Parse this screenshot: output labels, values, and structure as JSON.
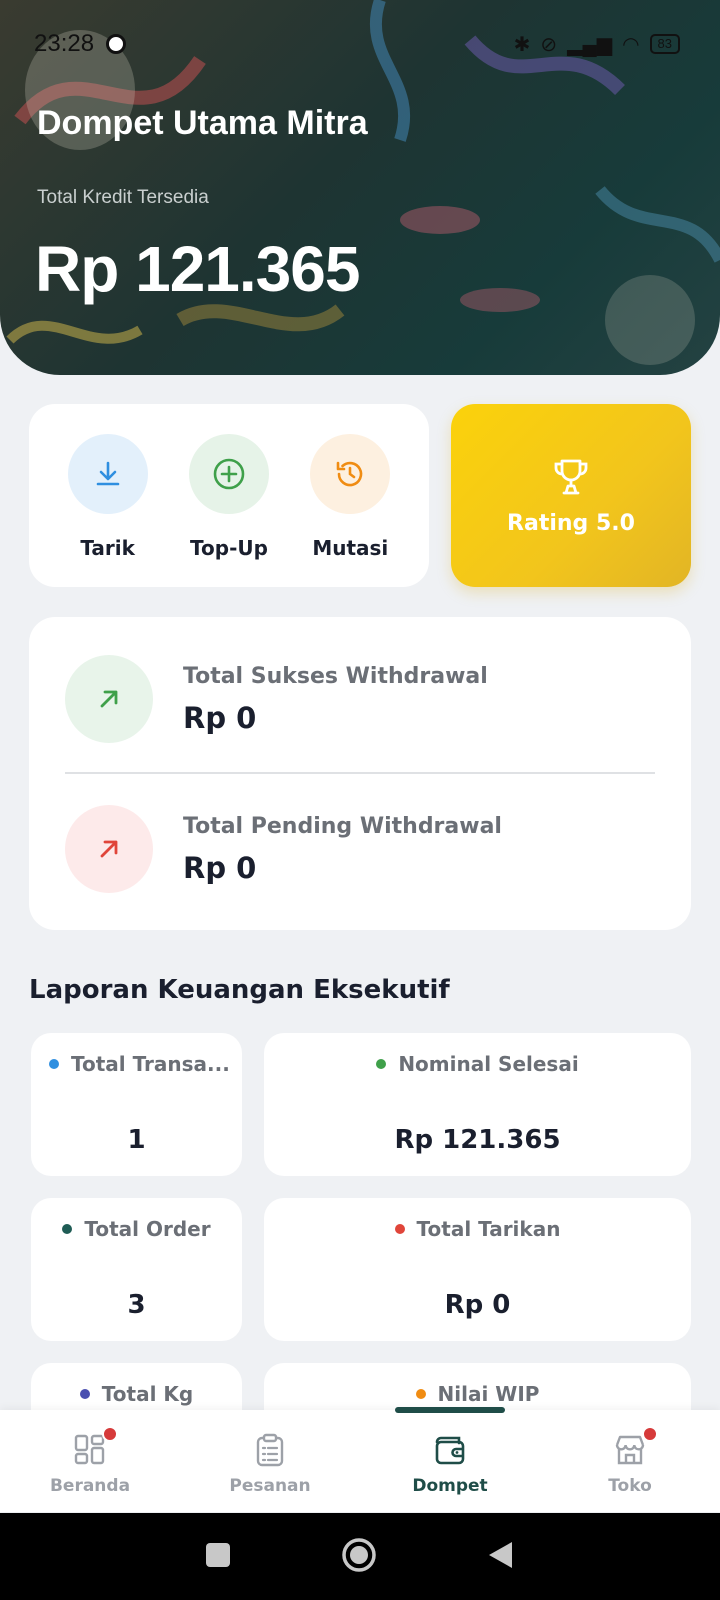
{
  "status_bar": {
    "time": "23:28",
    "battery": "83"
  },
  "wallet": {
    "title": "Dompet Utama Mitra",
    "subtitle": "Total Kredit Tersedia",
    "amount": "Rp 121.365"
  },
  "actions": [
    {
      "label": "Tarik",
      "icon": "download-icon"
    },
    {
      "label": "Top-Up",
      "icon": "plus-circle-icon"
    },
    {
      "label": "Mutasi",
      "icon": "history-icon"
    }
  ],
  "rating": {
    "label": "Rating 5.0",
    "icon": "trophy-icon"
  },
  "withdrawal": {
    "success": {
      "label": "Total Sukses Withdrawal",
      "value": "Rp 0"
    },
    "pending": {
      "label": "Total Pending Withdrawal",
      "value": "Rp 0"
    }
  },
  "report": {
    "title": "Laporan Keuangan Eksekutif",
    "stats": [
      {
        "label": "Total Transa...",
        "value": "1",
        "color": "#2f8fe0"
      },
      {
        "label": "Nominal Selesai",
        "value": "Rp 121.365",
        "color": "#3fa04a"
      },
      {
        "label": "Total Order",
        "value": "3",
        "color": "#1f5c55"
      },
      {
        "label": "Total Tarikan",
        "value": "Rp 0",
        "color": "#e0453a"
      },
      {
        "label": "Total Kg",
        "value": "",
        "color": "#4a4fb0"
      },
      {
        "label": "Nilai WIP",
        "value": "",
        "color": "#f08c12"
      }
    ]
  },
  "nav": {
    "items": [
      {
        "label": "Beranda",
        "icon": "grid-icon",
        "badge": true
      },
      {
        "label": "Pesanan",
        "icon": "clipboard-icon",
        "badge": false
      },
      {
        "label": "Dompet",
        "icon": "wallet-icon",
        "badge": false,
        "active": true
      },
      {
        "label": "Toko",
        "icon": "store-icon",
        "badge": true
      }
    ]
  }
}
